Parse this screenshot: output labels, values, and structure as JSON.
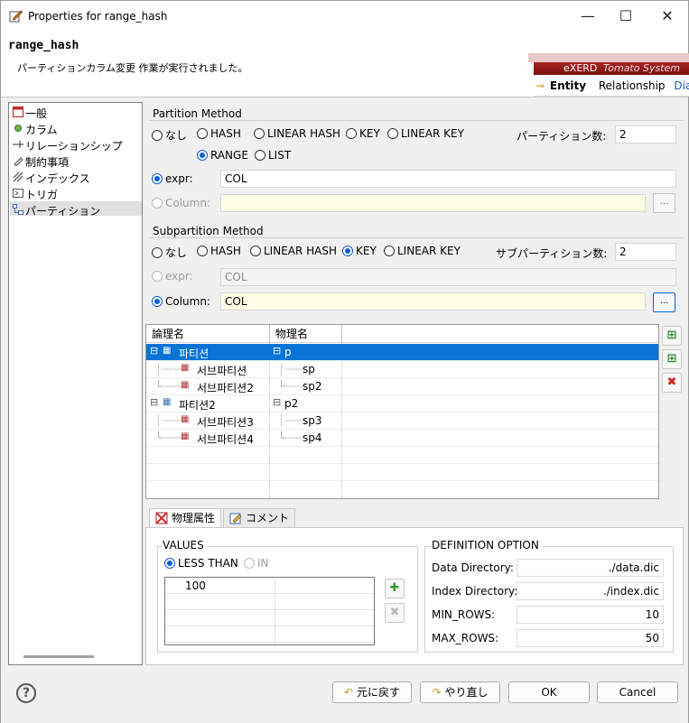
{
  "window": {
    "title": "Properties for range_hash",
    "minimize": "—",
    "maximize": "☐",
    "close": "✕"
  },
  "header": {
    "title": "range_hash",
    "message": "パーティションカラム変更 作業が実行されました。",
    "banner": {
      "product": "eXERD",
      "theme": "Tomato System",
      "tab_entity": "Entity",
      "tab_relationship": "Relationship",
      "tab_diagram": "Diag"
    }
  },
  "sidebar": {
    "items": [
      {
        "label": "一般",
        "icon": "table-icon"
      },
      {
        "label": "カラム",
        "icon": "column-dot-icon"
      },
      {
        "label": "リレーションシップ",
        "icon": "relationship-icon"
      },
      {
        "label": "制約事項",
        "icon": "constraint-icon"
      },
      {
        "label": "インデックス",
        "icon": "index-icon"
      },
      {
        "label": "トリガ",
        "icon": "trigger-icon"
      },
      {
        "label": "パーティション",
        "icon": "partition-icon"
      }
    ],
    "selected_index": 6
  },
  "partition": {
    "title": "Partition Method",
    "options": [
      "なし",
      "HASH",
      "LINEAR HASH",
      "KEY",
      "LINEAR KEY",
      "RANGE",
      "LIST"
    ],
    "selected": "RANGE",
    "count_label": "パーティション数:",
    "count_value": "2",
    "expr_label": "expr:",
    "expr_value": "COL",
    "column_label": "Column:",
    "column_value": "",
    "dots": "..."
  },
  "subpartition": {
    "title": "Subpartition Method",
    "options": [
      "なし",
      "HASH",
      "LINEAR HASH",
      "KEY",
      "LINEAR KEY"
    ],
    "selected": "KEY",
    "count_label": "サブパーティション数:",
    "count_value": "2",
    "expr_label": "expr:",
    "expr_value": "COL",
    "column_label": "Column:",
    "column_value": "COL",
    "dots": "..."
  },
  "grid": {
    "headers": [
      "論理名",
      "物理名"
    ],
    "rows": [
      {
        "logical": "파티션",
        "physical": "p",
        "level": 0,
        "selected": true
      },
      {
        "logical": "서브파티션",
        "physical": "sp",
        "level": 1
      },
      {
        "logical": "서브파티션2",
        "physical": "sp2",
        "level": 1
      },
      {
        "logical": "파티션2",
        "physical": "p2",
        "level": 0
      },
      {
        "logical": "서브파티션3",
        "physical": "sp3",
        "level": 1
      },
      {
        "logical": "서브파티션4",
        "physical": "sp4",
        "level": 1
      }
    ]
  },
  "tabs": {
    "physical": "物理属性",
    "comment": "コメント"
  },
  "values": {
    "title": "VALUES",
    "less_than": "LESS THAN",
    "in": "IN",
    "selected": "LESS THAN",
    "rows": [
      "100",
      "",
      "",
      ""
    ]
  },
  "definition": {
    "title": "DEFINITION OPTION",
    "data_dir_label": "Data Directory:",
    "data_dir_value": "./data.dic",
    "index_dir_label": "Index Directory:",
    "index_dir_value": "./index.dic",
    "min_rows_label": "MIN_ROWS:",
    "min_rows_value": "10",
    "max_rows_label": "MAX_ROWS:",
    "max_rows_value": "50"
  },
  "footer": {
    "help": "?",
    "revert": "元に戻す",
    "redo": "やり直し",
    "ok": "OK",
    "cancel": "Cancel"
  },
  "colors": {
    "accent": "#0b5fd6",
    "selection": "#0a73d6",
    "banner_red": "#a82424"
  }
}
